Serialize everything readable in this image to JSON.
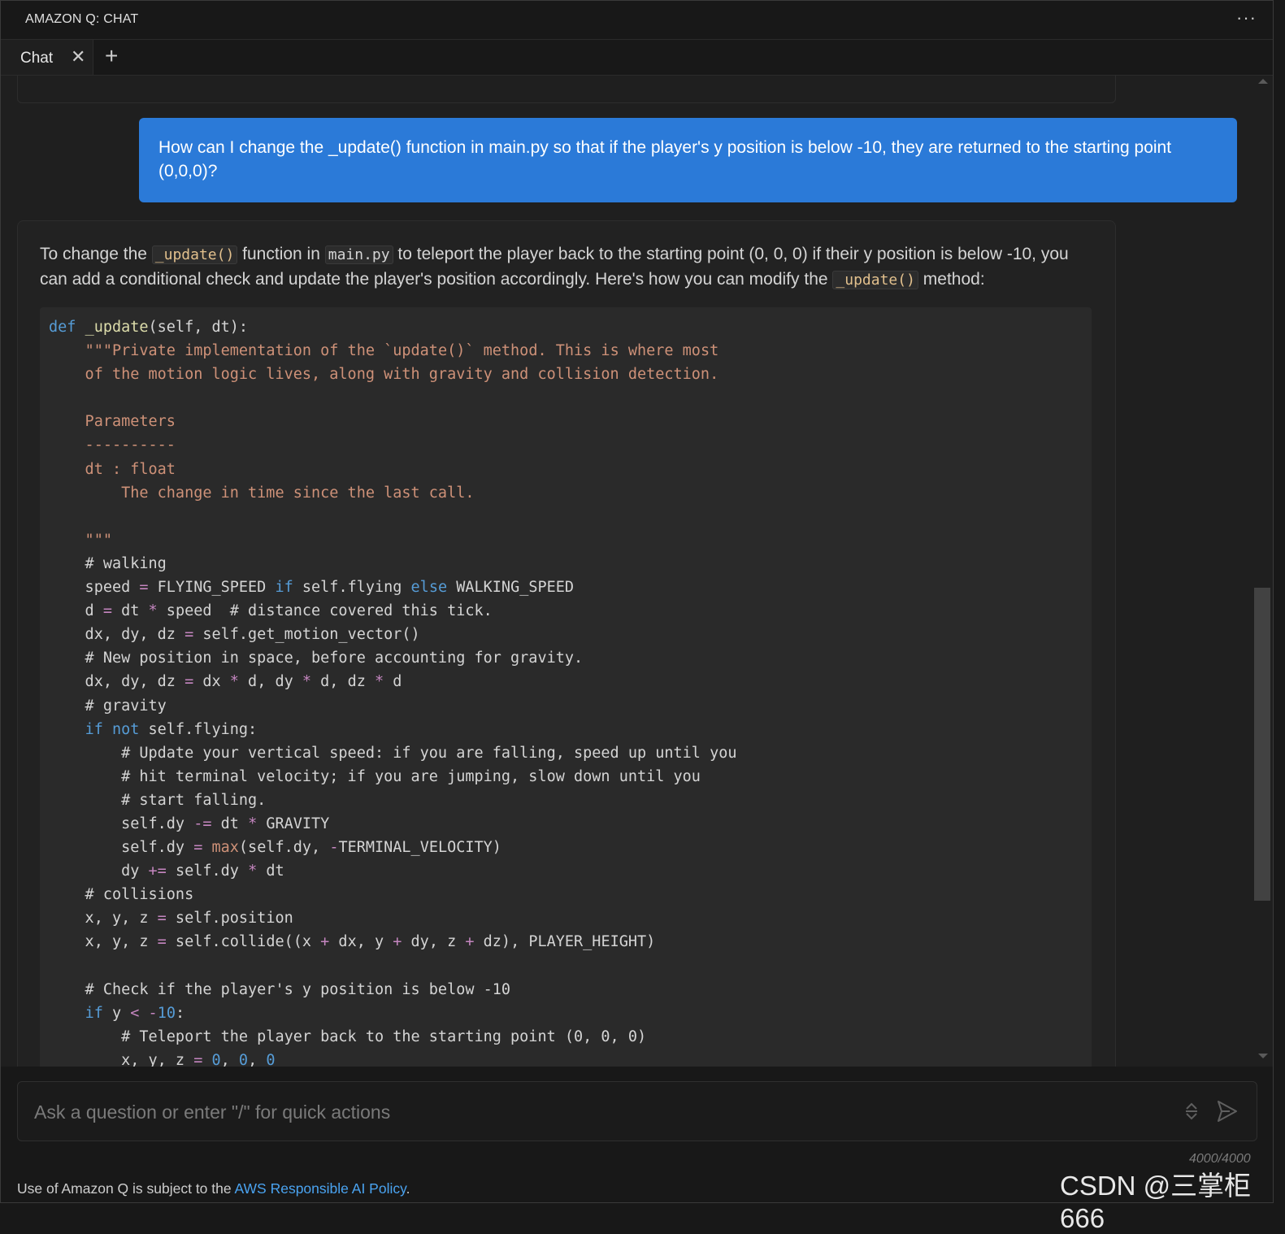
{
  "app": {
    "title": "AMAZON Q: CHAT",
    "more_menu": "···"
  },
  "tabs": [
    {
      "label": "Chat",
      "close": "✕"
    }
  ],
  "add_tab": "+",
  "conversation": {
    "user_message": "How can I change the _update() function in main.py so that if the player's y position is below -10, they are returned to the starting point (0,0,0)?",
    "assistant": {
      "intro_1": "To change the ",
      "code_1": "_update()",
      "intro_2": " function in ",
      "code_2": "main.py",
      "intro_3": " to teleport the player back to the starting point (0, 0, 0) if their y position is below -10, you can add a conditional check and update the player's position accordingly. Here's how you can modify the ",
      "code_3": "_update()",
      "intro_4": " method:"
    }
  },
  "input": {
    "placeholder": "Ask a question or enter \"/\" for quick actions",
    "value": "",
    "counter": "4000/4000"
  },
  "footer": {
    "text_before": "Use of Amazon Q is subject to the ",
    "link": "AWS Responsible AI Policy",
    "text_after": "."
  },
  "watermark": "CSDN @三掌柜666",
  "icons": {
    "more": "more-icon",
    "close": "close-icon",
    "add": "plus-icon",
    "stepper": "stepper-icon",
    "send": "send-icon"
  },
  "colors": {
    "accent": "#2b7ad8",
    "background": "#1f1f1f",
    "link": "#4aa3f0"
  }
}
